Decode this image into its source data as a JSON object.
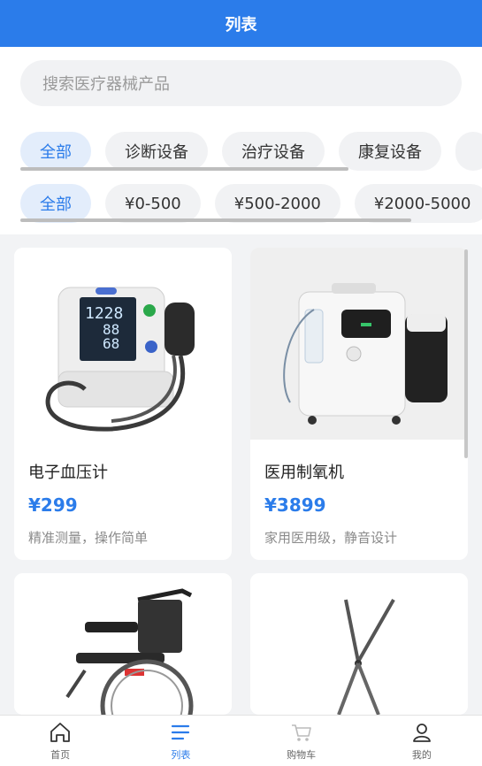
{
  "header": {
    "title": "列表"
  },
  "search": {
    "placeholder": "搜索医疗器械产品"
  },
  "categories": [
    "全部",
    "诊断设备",
    "治疗设备",
    "康复设备"
  ],
  "price_ranges": [
    "全部",
    "¥0-500",
    "¥500-2000",
    "¥2000-5000"
  ],
  "products": [
    {
      "name": "电子血压计",
      "price": "¥299",
      "desc": "精准测量，操作简单",
      "icon": "blood-pressure-monitor-image"
    },
    {
      "name": "医用制氧机",
      "price": "¥3899",
      "desc": "家用医用级，静音设计",
      "icon": "oxygen-concentrator-image"
    },
    {
      "icon": "wheelchair-image"
    },
    {
      "icon": "surgical-scissors-image"
    }
  ],
  "tabbar": [
    {
      "label": "首页",
      "icon": "home-icon"
    },
    {
      "label": "列表",
      "icon": "list-icon"
    },
    {
      "label": "购物车",
      "icon": "cart-icon"
    },
    {
      "label": "我的",
      "icon": "user-icon"
    }
  ],
  "colors": {
    "primary": "#2b7cea",
    "chip_active_bg": "#e3edfb",
    "background": "#f2f3f5"
  }
}
